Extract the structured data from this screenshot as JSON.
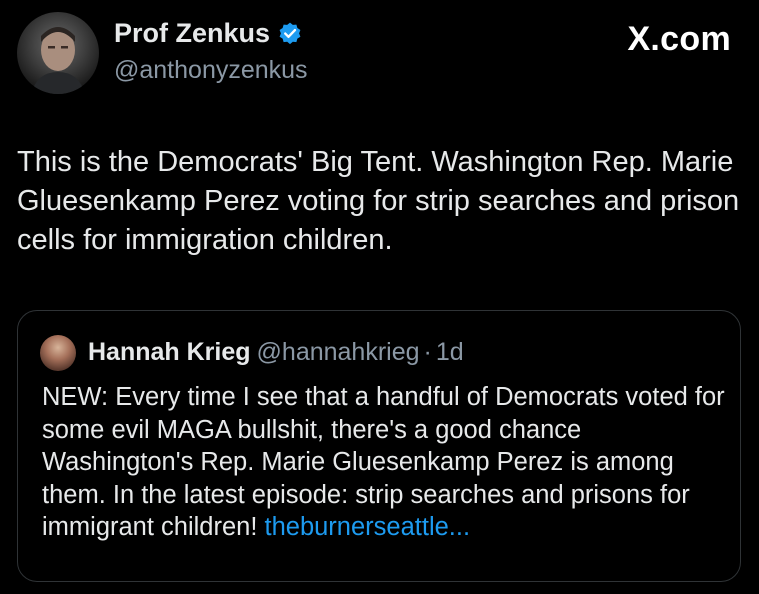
{
  "author": {
    "name": "Prof Zenkus",
    "handle": "@anthonyzenkus",
    "verified_icon": "verified-badge",
    "verified_color": "#1d9bf0"
  },
  "brand": "X.com",
  "tweet": {
    "text": "This is the Democrats' Big Tent. Washington Rep. Marie Gluesenkamp Perez voting for strip searches and prison cells for immigration children."
  },
  "quote": {
    "name": "Hannah Krieg",
    "handle": "@hannahkrieg",
    "separator": "·",
    "time": "1d",
    "text": "NEW: Every time I see that a handful of Democrats voted for some evil MAGA bullshit, there's a good chance Washington's Rep. Marie Gluesenkamp Perez is among them. In the latest episode: strip searches and prisons for immigrant children!",
    "link": "theburnerseattle...",
    "link_color": "#1d9bf0"
  },
  "colors": {
    "background": "#000000",
    "text": "#e7e9ea",
    "secondary": "#8b98a5",
    "border": "#2f3336"
  }
}
